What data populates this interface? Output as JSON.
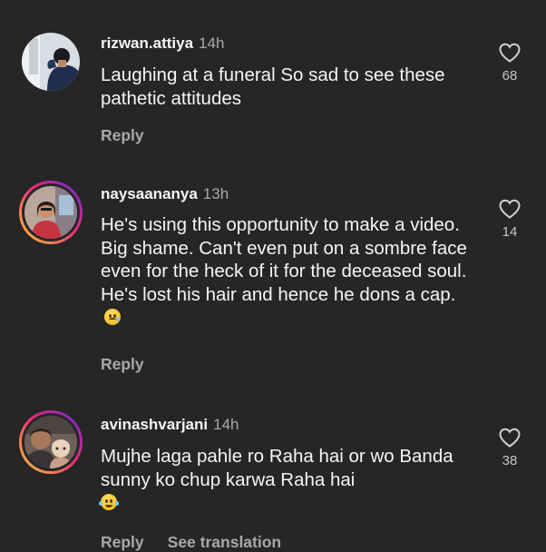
{
  "comments": [
    {
      "username": "rizwan.attiya",
      "time": "14h",
      "text": "Laughing at a funeral So sad to see these pathetic attitudes",
      "likes": "68",
      "reply": "Reply",
      "has_story_ring": false
    },
    {
      "username": "naysaananya",
      "time": "13h",
      "text": "He's using this opportunity to make a video. Big shame. Can't even put on a sombre face even for the heck of it for the deceased soul. He's lost his hair and hence he dons a cap.",
      "emoji": "sad-face-emoji",
      "likes": "14",
      "reply": "Reply",
      "has_story_ring": true
    },
    {
      "username": "avinashvarjani",
      "time": "14h",
      "text": "Mujhe laga pahle ro Raha hai or wo Banda sunny ko chup karwa Raha hai",
      "emoji": "tears-of-joy-emoji",
      "likes": "38",
      "reply": "Reply",
      "see_translation": "See translation",
      "has_story_ring": true
    }
  ],
  "icons": {
    "like": "heart-outline-icon"
  },
  "colors": {
    "background": "#262626",
    "primary_text": "#f5f5f5",
    "secondary_text": "#a8a8a8"
  }
}
